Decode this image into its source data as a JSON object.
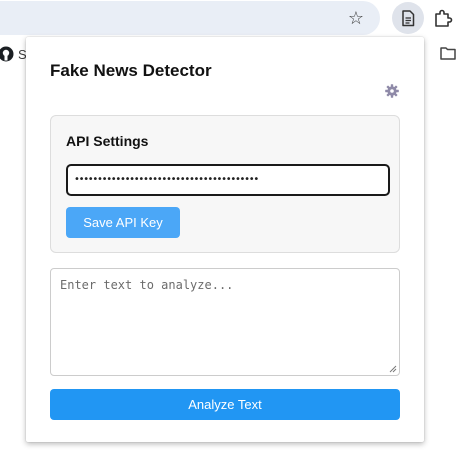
{
  "browser": {
    "star_icon": "star-outline-icon",
    "extension_icon": "document-icon",
    "puzzle_icon": "puzzle-icon",
    "bookmark_label": "Se",
    "folder_icon": "folder-icon"
  },
  "popup": {
    "title": "Fake News Detector",
    "settings_icon": "gear-icon",
    "api_settings": {
      "heading": "API Settings",
      "api_key_value": "••••••••••••••••••••••••••••••••••••••••",
      "save_label": "Save API Key"
    },
    "analyze": {
      "placeholder": "Enter text to analyze...",
      "button_label": "Analyze Text"
    }
  },
  "colors": {
    "save_button": "#4ba7f7",
    "analyze_button": "#2196f3",
    "card_background": "#f7f7f7"
  }
}
